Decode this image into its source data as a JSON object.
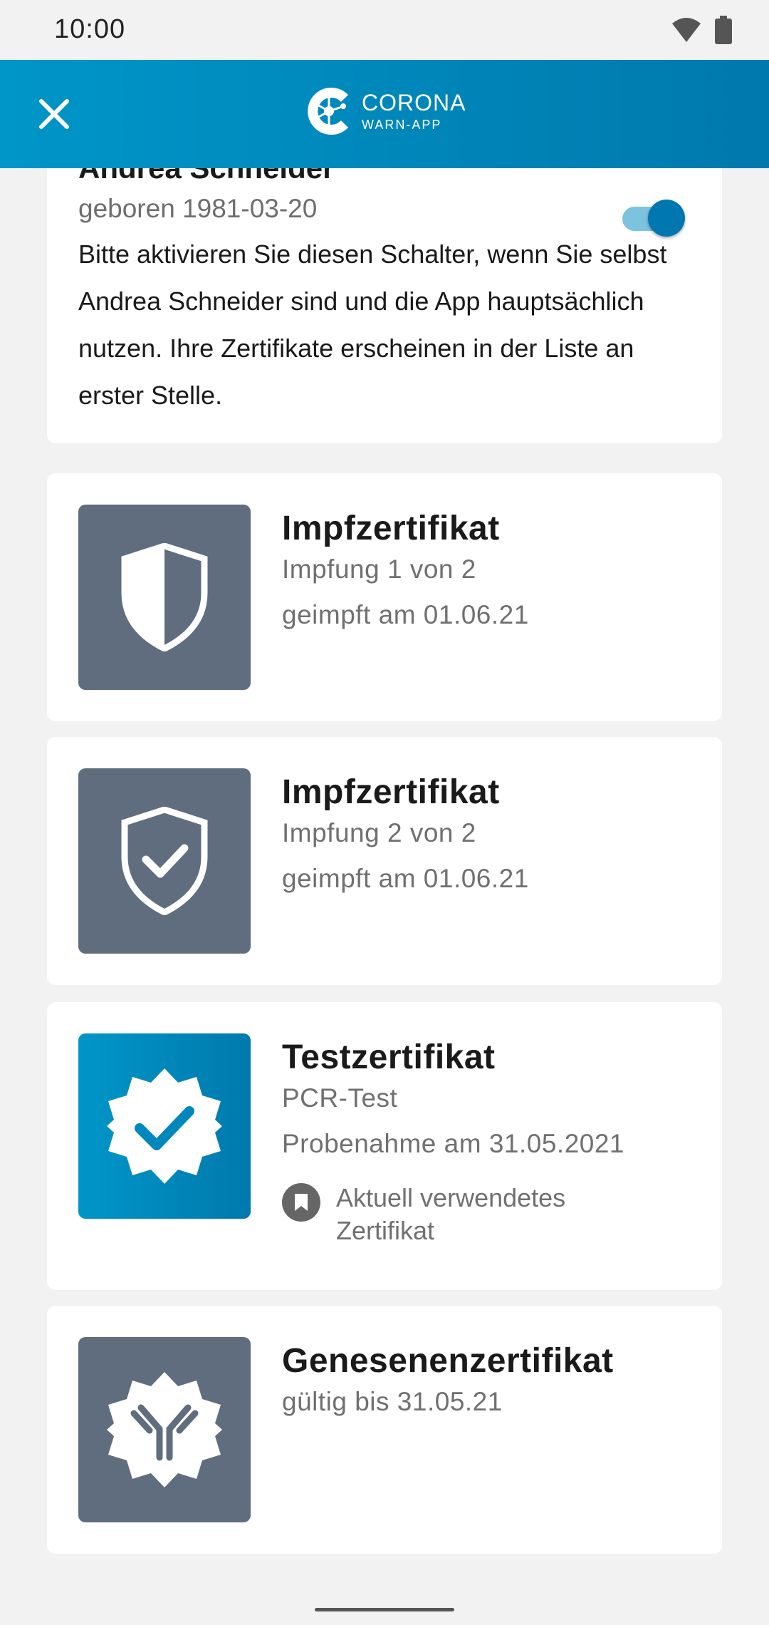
{
  "status_bar": {
    "time": "10:00",
    "icons": [
      "wifi-icon",
      "battery-icon"
    ]
  },
  "app_bar": {
    "logo_title": "CORONA",
    "logo_subtitle": "WARN-APP",
    "close_icon": "close-icon"
  },
  "person": {
    "name": "Andrea Schneider",
    "birth": "geboren 1981-03-20",
    "description": "Bitte aktivieren Sie diesen Schalter, wenn Sie selbst Andrea Schneider sind und die App hauptsächlich nutzen. Ihre Zertifikate erscheinen in der Liste an erster Stelle.",
    "toggle_on": true
  },
  "certificates": [
    {
      "title": "Impfzertifikat",
      "line1": "Impfung 1 von 2",
      "line2": "geimpft am 01.06.21",
      "icon": "half-shield-icon"
    },
    {
      "title": "Impfzertifikat",
      "line1": "Impfung 2 von 2",
      "line2": "geimpft am 01.06.21",
      "icon": "shield-check-icon"
    },
    {
      "title": "Testzertifikat",
      "line1": "PCR-Test",
      "line2": "Probenahme am 31.05.2021",
      "icon": "badge-check-icon",
      "badge": "Aktuell verwendetes Zertifikat",
      "badge_icon": "bookmark-icon"
    },
    {
      "title": "Genesenenzertifikat",
      "line1": "gültig bis 31.05.21",
      "icon": "antibody-icon"
    }
  ],
  "colors": {
    "brand_blue": "#0096c8",
    "icon_gray": "#5f6d7e",
    "background": "#f2f2f2"
  }
}
